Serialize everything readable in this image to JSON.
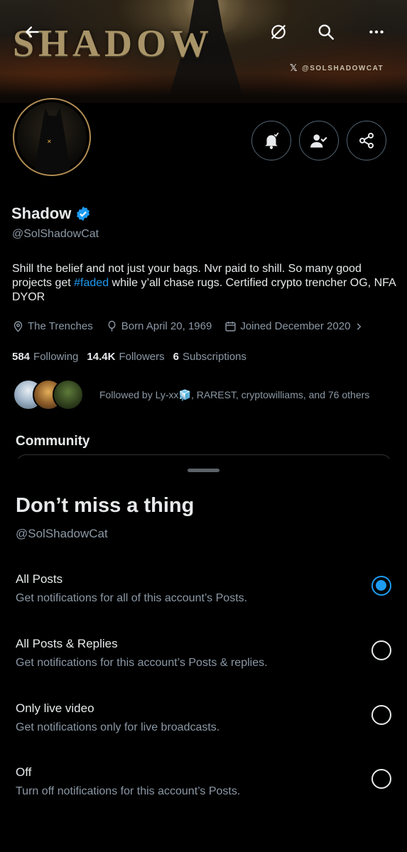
{
  "banner": {
    "title": "SHADOW",
    "handle": "@SOLSHADOWCAT",
    "x_logo": "𝕏"
  },
  "topbar": {
    "back_icon": "arrow-left-icon",
    "icons": [
      "eye-off-icon",
      "search-icon",
      "more-icon"
    ]
  },
  "profile": {
    "name": "Shadow",
    "verified_color": "#1d9bf0",
    "handle": "@SolShadowCat",
    "bio_before": "Shill the belief and not just your bags. Nvr paid to shill. So many good projects get ",
    "bio_hashtag": "#faded",
    "bio_after": " while y’all chase rugs. Certified crypto trencher OG, NFA DYOR",
    "location": "The Trenches",
    "birthday": "Born April 20, 1969",
    "joined": "Joined December 2020",
    "following_count": "584",
    "following_label": "Following",
    "followers_count": "14.4K",
    "followers_label": "Followers",
    "subscriptions_count": "6",
    "subscriptions_label": "Subscriptions",
    "followed_by": "Followed by Ly-xx🧊, RAREST, cryptowilliams, and 76 others",
    "community_label": "Community"
  },
  "actions": [
    "notification-bell-icon",
    "follow-check-icon",
    "share-icon"
  ],
  "sheet": {
    "title": "Don’t miss a thing",
    "handle": "@SolShadowCat",
    "options": [
      {
        "title": "All Posts",
        "subtitle": "Get notifications for all of this account’s Posts.",
        "selected": true
      },
      {
        "title": "All Posts & Replies",
        "subtitle": "Get notifications for this account’s Posts & replies.",
        "selected": false
      },
      {
        "title": "Only live video",
        "subtitle": "Get notifications only for live broadcasts.",
        "selected": false
      },
      {
        "title": "Off",
        "subtitle": "Turn off notifications for this account’s Posts.",
        "selected": false
      }
    ]
  },
  "colors": {
    "accent": "#1d9bf0",
    "secondary_text": "#8b98a5",
    "primary_text": "#e7e9ea"
  }
}
